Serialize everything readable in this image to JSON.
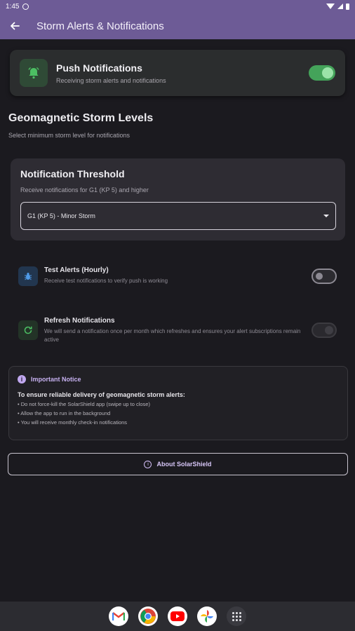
{
  "status_bar": {
    "time": "1:45"
  },
  "app_bar": {
    "title": "Storm Alerts & Notifications"
  },
  "push": {
    "title": "Push Notifications",
    "subtitle": "Receiving storm alerts and notifications",
    "enabled": true
  },
  "levels": {
    "title": "Geomagnetic Storm Levels",
    "subtitle": "Select minimum storm level for notifications"
  },
  "threshold": {
    "title": "Notification Threshold",
    "subtitle": "Receive notifications for G1 (KP 5) and higher",
    "selected": "G1 (KP 5) - Minor Storm"
  },
  "test_alerts": {
    "title": "Test Alerts (Hourly)",
    "subtitle": "Receive test notifications to verify push is working",
    "enabled": false
  },
  "refresh": {
    "title": "Refresh Notifications",
    "subtitle": "We will send a notification once per month which refreshes and ensures your alert subscriptions remain active",
    "enabled": false
  },
  "notice": {
    "title": "Important Notice",
    "lead": "To ensure reliable delivery of geomagnetic storm alerts:",
    "items": [
      "• Do not force-kill the SolarShield app (swipe up to close)",
      "• Allow the app to run in the background",
      "• You will receive monthly check-in notifications"
    ]
  },
  "about": {
    "label": "About SolarShield"
  },
  "colors": {
    "app_bar": "#6d5b96",
    "toggle_on": "#44a35a",
    "accent": "#c7b1f1"
  },
  "dock": {
    "apps": [
      "gmail-icon",
      "chrome-icon",
      "youtube-icon",
      "photos-icon",
      "app-drawer-icon"
    ]
  }
}
